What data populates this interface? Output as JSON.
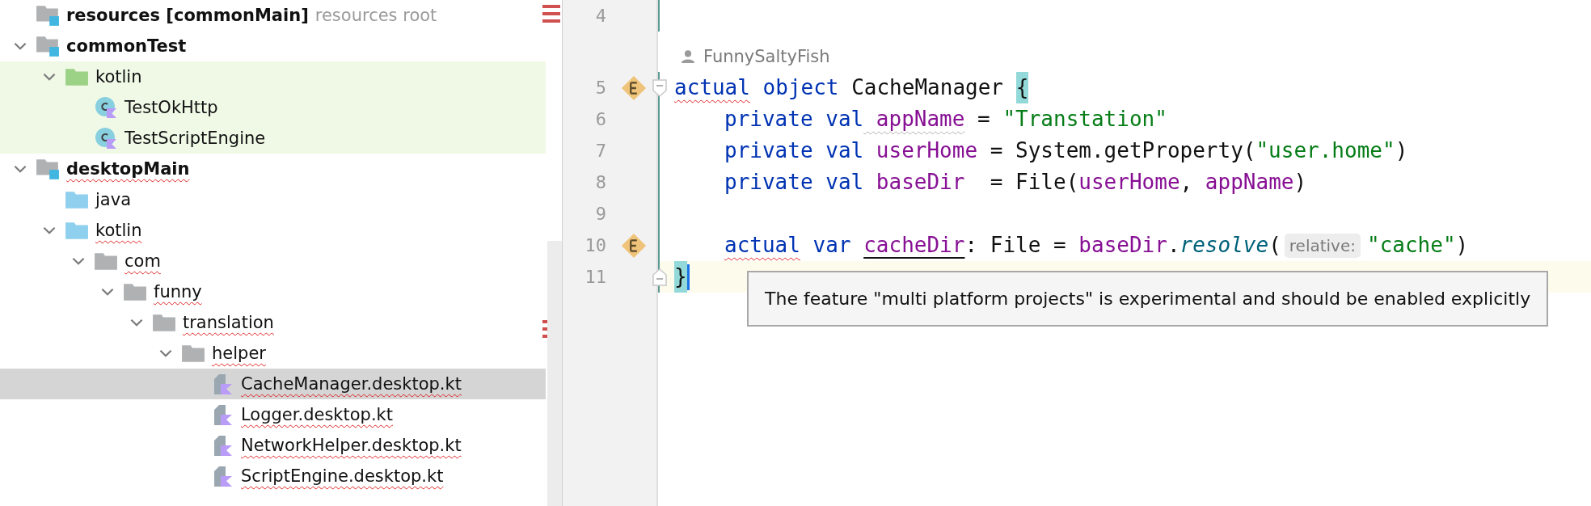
{
  "project_tree": [
    {
      "label": "resources [commonMain]",
      "suffix": "resources root",
      "kind": "module",
      "bold": true,
      "error": false,
      "selected": false
    },
    {
      "label": "commonTest",
      "kind": "module",
      "bold": true,
      "error": false,
      "selected": false,
      "expanded": true,
      "children": [
        {
          "label": "kotlin",
          "kind": "test_folder",
          "bold": false,
          "error": false,
          "selected": false,
          "expanded": true,
          "children": [
            {
              "label": "TestOkHttp",
              "kind": "class",
              "bold": false,
              "error": false,
              "selected": false
            },
            {
              "label": "TestScriptEngine",
              "kind": "class",
              "bold": false,
              "error": false,
              "selected": false
            }
          ]
        }
      ]
    },
    {
      "label": "desktopMain",
      "kind": "module",
      "bold": true,
      "error": true,
      "selected": false,
      "expanded": true,
      "children": [
        {
          "label": "java",
          "kind": "source_folder",
          "bold": false,
          "error": false,
          "selected": false
        },
        {
          "label": "kotlin",
          "kind": "source_folder",
          "bold": false,
          "error": true,
          "selected": false,
          "expanded": true,
          "children": [
            {
              "label": "com",
              "kind": "folder",
              "bold": false,
              "error": true,
              "selected": false,
              "expanded": true,
              "children": [
                {
                  "label": "funny",
                  "kind": "folder",
                  "bold": false,
                  "error": true,
                  "selected": false,
                  "expanded": true,
                  "children": [
                    {
                      "label": "translation",
                      "kind": "folder",
                      "bold": false,
                      "error": true,
                      "selected": false,
                      "expanded": true,
                      "children": [
                        {
                          "label": "helper",
                          "kind": "folder",
                          "bold": false,
                          "error": true,
                          "selected": false,
                          "expanded": true,
                          "children": [
                            {
                              "label": "CacheManager.desktop.kt",
                              "kind": "kotlin_file",
                              "bold": false,
                              "error": true,
                              "selected": true
                            },
                            {
                              "label": "Logger.desktop.kt",
                              "kind": "kotlin_file",
                              "bold": false,
                              "error": true,
                              "selected": false
                            },
                            {
                              "label": "NetworkHelper.desktop.kt",
                              "kind": "kotlin_file",
                              "bold": false,
                              "error": true,
                              "selected": false
                            },
                            {
                              "label": "ScriptEngine.desktop.kt",
                              "kind": "kotlin_file",
                              "bold": false,
                              "error": true,
                              "selected": false
                            }
                          ]
                        }
                      ]
                    }
                  ]
                }
              ]
            }
          ]
        }
      ]
    }
  ],
  "editor": {
    "lines": [
      {
        "number": "4",
        "kind": "code"
      },
      {
        "kind": "author",
        "author": "FunnySaltyFish"
      },
      {
        "number": "5",
        "kind": "code",
        "marker": true,
        "fold_start": true,
        "tokens": [
          {
            "kind": "code",
            "text": "actual",
            "color": "#0033b3",
            "error": true
          },
          {
            "kind": "code",
            "text": " object",
            "color": "#0033b3"
          },
          {
            "kind": "code",
            "text": " CacheManager ",
            "color": "#111111"
          },
          {
            "kind": "code",
            "text": "{",
            "matched": true
          }
        ]
      },
      {
        "number": "6",
        "kind": "code",
        "indented": true,
        "tokens": [
          {
            "kind": "code",
            "text": "private val",
            "color": "#0033b3"
          },
          {
            "kind": "code",
            "text": " appName",
            "color": "#871094",
            "weak_warning": true
          },
          {
            "kind": "code",
            "text": " = ",
            "color": "#111111"
          },
          {
            "kind": "code",
            "text": "\"Transtation\"",
            "color": "#067d17"
          }
        ]
      },
      {
        "number": "7",
        "kind": "code",
        "indented": true,
        "tokens": [
          {
            "kind": "code",
            "text": "private val",
            "color": "#0033b3"
          },
          {
            "kind": "code",
            "text": " userHome",
            "color": "#871094"
          },
          {
            "kind": "code",
            "text": " = System.getProperty(",
            "color": "#111111"
          },
          {
            "kind": "code",
            "text": "\"user.home\"",
            "color": "#067d17"
          },
          {
            "kind": "code",
            "text": ")",
            "color": "#111111"
          }
        ]
      },
      {
        "number": "8",
        "kind": "code",
        "indented": true,
        "tokens": [
          {
            "kind": "code",
            "text": "private val",
            "color": "#0033b3"
          },
          {
            "kind": "code",
            "text": " baseDir",
            "color": "#871094"
          },
          {
            "kind": "code",
            "text": "  = File(",
            "color": "#111111"
          },
          {
            "kind": "code",
            "text": "userHome",
            "color": "#871094"
          },
          {
            "kind": "code",
            "text": ", ",
            "color": "#111111"
          },
          {
            "kind": "code",
            "text": "appName",
            "color": "#871094"
          },
          {
            "kind": "code",
            "text": ")",
            "color": "#111111"
          }
        ]
      },
      {
        "number": "9",
        "kind": "code"
      },
      {
        "number": "10",
        "kind": "code",
        "indented": true,
        "marker": true,
        "tokens": [
          {
            "kind": "code",
            "text": "actual",
            "color": "#0033b3",
            "error": true
          },
          {
            "kind": "code",
            "text": " var ",
            "color": "#0033b3"
          },
          {
            "kind": "code",
            "text": "cacheDir",
            "color": "#871094",
            "underline": true
          },
          {
            "kind": "code",
            "text": ": File = ",
            "color": "#111111"
          },
          {
            "kind": "code",
            "text": "baseDir",
            "color": "#871094"
          },
          {
            "kind": "code",
            "text": ".",
            "color": "#111111"
          },
          {
            "kind": "code",
            "text": "resolve",
            "color": "#00627a",
            "italic": true
          },
          {
            "kind": "code",
            "text": "(",
            "color": "#111111"
          },
          {
            "kind": "hint",
            "text": "relative:",
            "color": "#7a7a7a"
          },
          {
            "kind": "code",
            "text": "\"cache\"",
            "color": "#067d17"
          },
          {
            "kind": "code",
            "text": ")",
            "color": "#111111"
          }
        ]
      },
      {
        "number": "11",
        "kind": "code",
        "current": true,
        "fold_end": true,
        "tokens": [
          {
            "kind": "code",
            "text": "}",
            "matched": true
          }
        ]
      }
    ],
    "tooltip": "The feature \"multi platform projects\" is experimental and should be enabled explicitly"
  }
}
